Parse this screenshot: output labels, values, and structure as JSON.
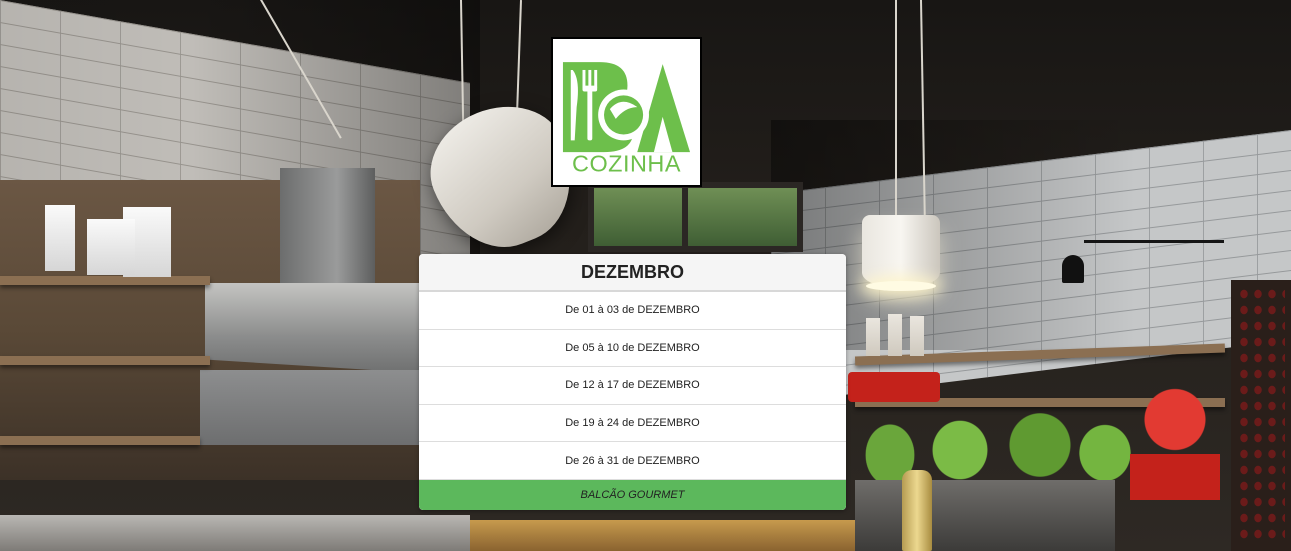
{
  "logo": {
    "letters": "BA",
    "word": "COZINHA",
    "brand_color": "#6dbf4b",
    "icon": "fork-knife-icon"
  },
  "schedule": {
    "month_title": "DEZEMBRO",
    "items": [
      {
        "label": "De 01 à 03 de DEZEMBRO"
      },
      {
        "label": "De 05 à 10 de DEZEMBRO"
      },
      {
        "label": "De 12 à 17 de DEZEMBRO"
      },
      {
        "label": "De 19 à 24 de DEZEMBRO"
      },
      {
        "label": "De 26 à 31 de DEZEMBRO"
      }
    ],
    "cta_label": "BALCÃO GOURMET",
    "cta_color": "#5cb85c"
  }
}
